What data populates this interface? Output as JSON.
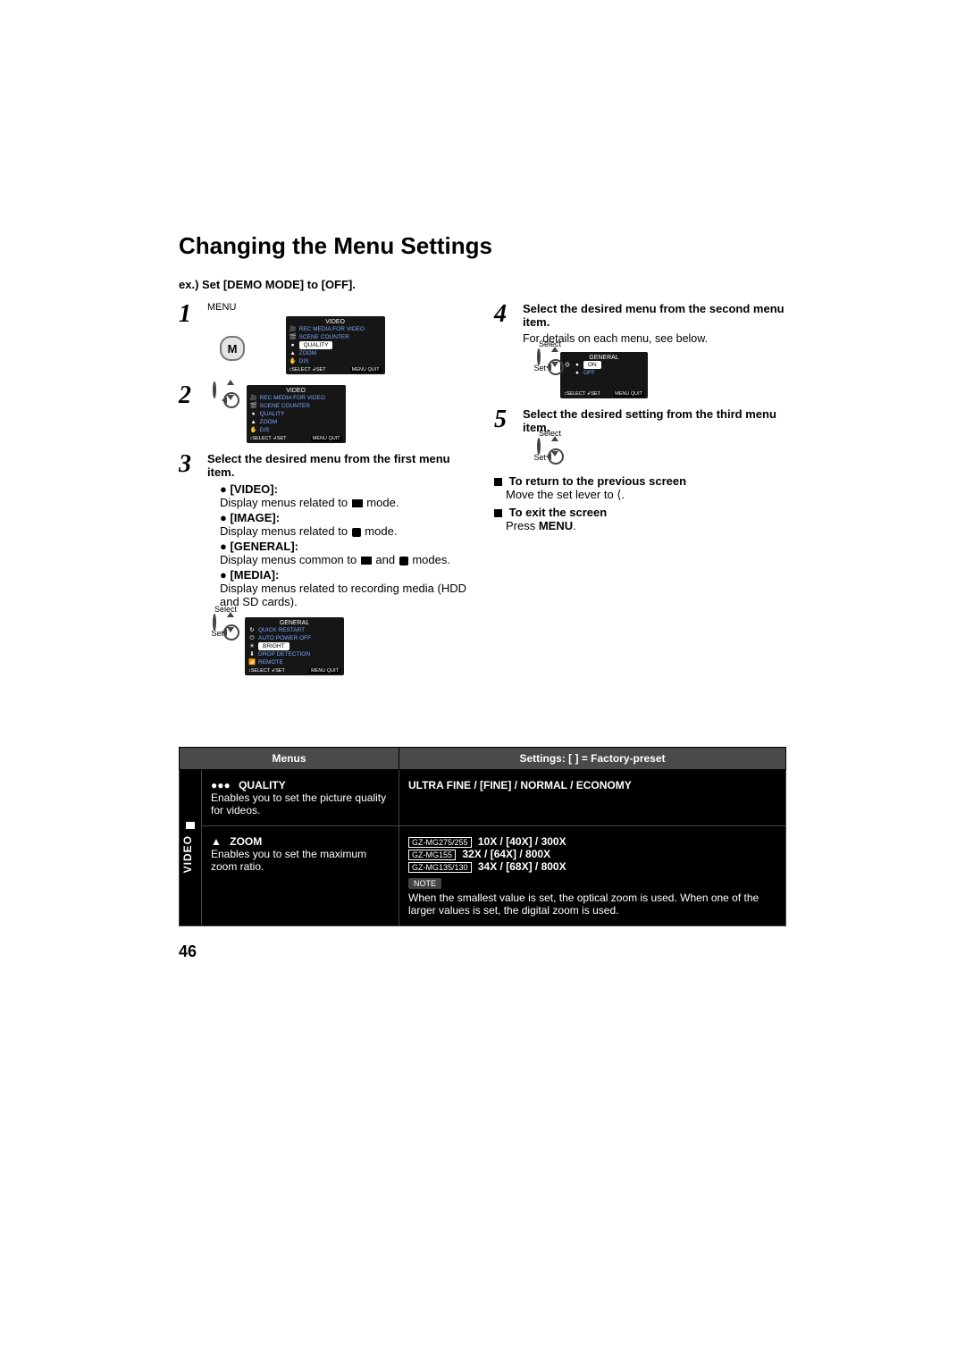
{
  "title": "Changing the Menu Settings",
  "example": "ex.) Set [DEMO MODE] to [OFF].",
  "left": {
    "step1": {
      "num": "1",
      "menu_label": "MENU"
    },
    "step2": {
      "num": "2"
    },
    "step3": {
      "num": "3",
      "text": "Select the desired menu from the first menu item.",
      "items": {
        "video_label": "[VIDEO]:",
        "video_desc_a": "Display menus related to ",
        "video_desc_b": " mode.",
        "image_label": "[IMAGE]:",
        "image_desc_a": "Display menus related to ",
        "image_desc_b": " mode.",
        "general_label": "[GENERAL]:",
        "general_desc_a": "Display menus common to ",
        "general_desc_and": " and ",
        "general_desc_b": " modes.",
        "media_label": "[MEDIA]:",
        "media_desc": "Display menus related to recording media (HDD and SD cards)."
      },
      "select_label": "Select",
      "set_label": "Set"
    },
    "osd_video_title": "VIDEO",
    "osd_general_title": "GENERAL",
    "osd": {
      "video": {
        "r1": "REC MEDIA FOR VIDEO",
        "r2": "SCENE COUNTER",
        "r3": "QUALITY",
        "r4": "ZOOM",
        "r5": "DIS"
      },
      "general": {
        "r1": "QUICK RESTART",
        "r2": "AUTO POWER OFF",
        "r3": "BRIGHT",
        "r4": "DROP DETECTION",
        "r5": "REMOTE"
      },
      "foot_select": "SELECT",
      "foot_set": "SET",
      "foot_menu": "MENU",
      "foot_quit": "QUIT"
    }
  },
  "right": {
    "step4": {
      "num": "4",
      "text": "Select the desired menu from the second menu item.",
      "sub": "For details on each menu, see below.",
      "select_label": "Select",
      "set_label": "Set"
    },
    "osd_general_title": "GENERAL",
    "osd_general": {
      "r1": "ON",
      "r2": "OFF"
    },
    "step5": {
      "num": "5",
      "text": "Select the desired setting from the third menu item.",
      "select_label": "Select",
      "set_label": "Set"
    },
    "return_title": "To return to the previous screen",
    "return_body": "Move the set lever to ⟨.",
    "exit_title": "To exit the screen",
    "exit_body_a": "Press ",
    "exit_body_b": "MENU",
    "exit_body_c": "."
  },
  "table": {
    "head_menus": "Menus",
    "head_settings": "Settings: [ ] = Factory-preset",
    "section_label": "VIDEO",
    "quality": {
      "icon": "●●●",
      "name": "QUALITY",
      "desc": "Enables you to set the picture quality for videos.",
      "settings": "ULTRA FINE / [FINE] / NORMAL / ECONOMY"
    },
    "zoom": {
      "icon": "▲",
      "name": "ZOOM",
      "desc": "Enables you to set the maximum zoom ratio.",
      "model1": "GZ-MG275/255",
      "model1_vals": "10X / [40X] / 300X",
      "model2": "GZ-MG155",
      "model2_vals": "32X / [64X] / 800X",
      "model3": "GZ-MG135/130",
      "model3_vals": "34X / [68X] / 800X",
      "note_label": "NOTE",
      "note_body": "When the smallest value is set, the optical zoom is used. When one of the larger values is set, the digital zoom is used."
    }
  },
  "page_number": "46"
}
